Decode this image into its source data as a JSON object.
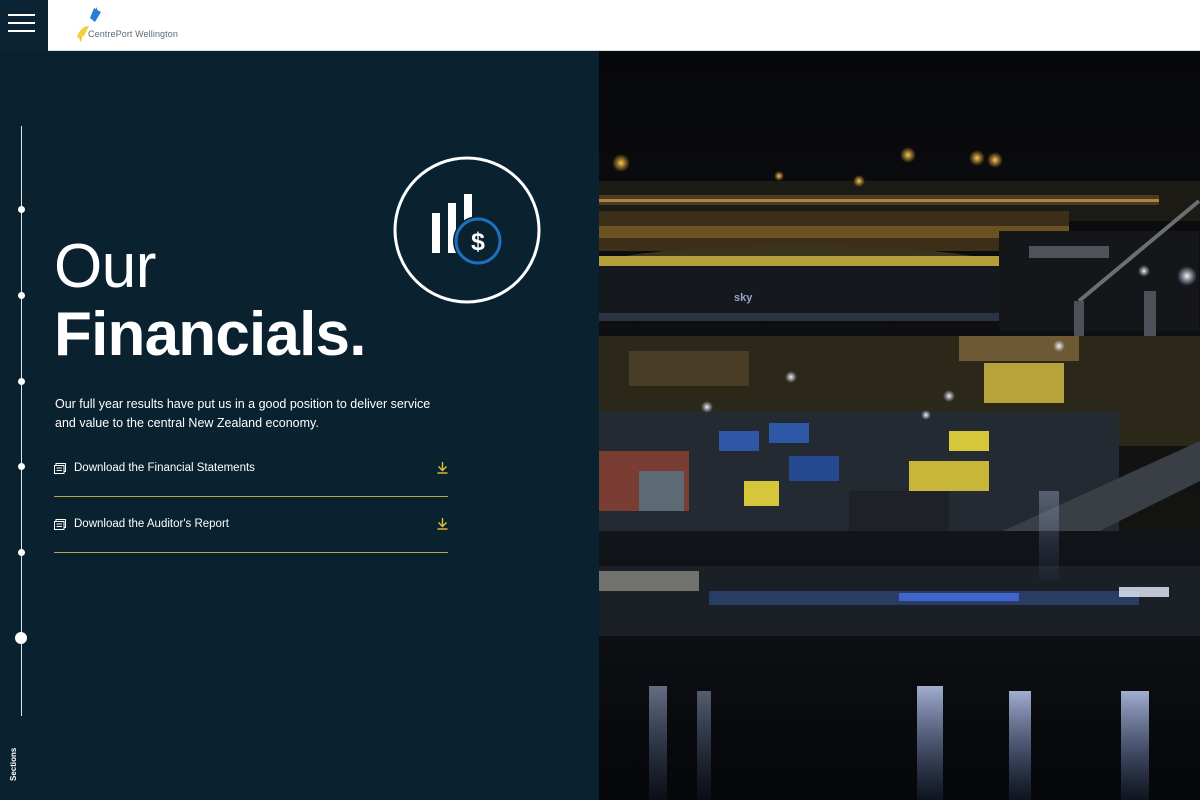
{
  "header": {
    "menu_icon": "hamburger-menu-icon",
    "logo_text": "CentrePort Wellington",
    "logo_colors": {
      "blue": "#1f6fbf",
      "yellow": "#f1c21b"
    }
  },
  "sidebar": {
    "label": "Sections",
    "dots": 6,
    "active_index": 5
  },
  "main": {
    "title_line1": "Our",
    "title_line2": "Financials.",
    "intro": "Our full year results have put us in a good position to deliver service and value to the central New Zealand economy.",
    "hero_icon": "financial-chart-dollar-icon",
    "downloads": [
      {
        "label": "Download the Financial Statements",
        "icon": "document-icon",
        "action_icon": "download-arrow-icon"
      },
      {
        "label": "Download the Auditor's Report",
        "icon": "document-icon",
        "action_icon": "download-arrow-icon"
      }
    ]
  },
  "photo": {
    "subject": "night-port-image"
  },
  "colors": {
    "panel_bg": "#0a2130",
    "accent_gold": "#e2c332",
    "accent_blue": "#1f6fbf",
    "divider": "#b9a64f"
  }
}
